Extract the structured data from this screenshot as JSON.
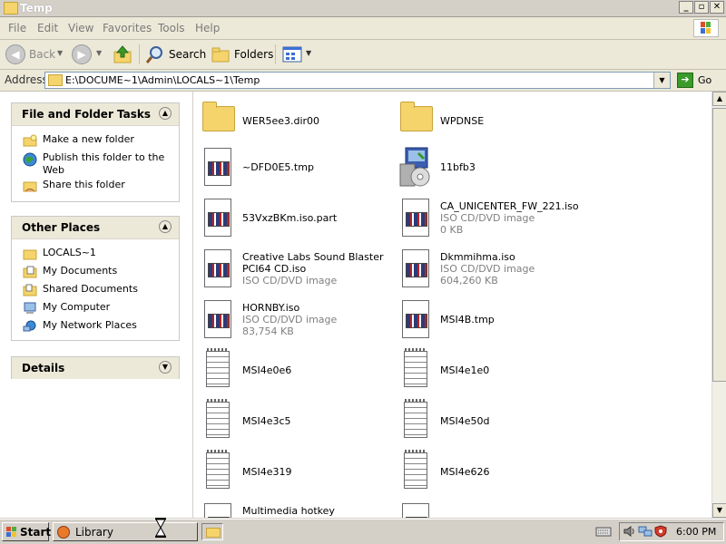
{
  "window": {
    "title": "Temp"
  },
  "menu": [
    "File",
    "Edit",
    "View",
    "Favorites",
    "Tools",
    "Help"
  ],
  "toolbar": {
    "back": "Back",
    "search": "Search",
    "folders": "Folders"
  },
  "address": {
    "label": "Address",
    "value": "E:\\DOCUME~1\\Admin\\LOCALS~1\\Temp",
    "go": "Go"
  },
  "left_panels": {
    "tasks": {
      "title": "File and Folder Tasks",
      "items": [
        "Make a new folder",
        "Publish this folder to the Web",
        "Share this folder"
      ]
    },
    "places": {
      "title": "Other Places",
      "items": [
        "LOCALS~1",
        "My Documents",
        "Shared Documents",
        "My Computer",
        "My Network Places"
      ]
    },
    "details": {
      "title": "Details"
    }
  },
  "files": [
    {
      "name": "WER5ee3.dir00",
      "icon": "folder"
    },
    {
      "name": "WPDNSE",
      "icon": "folder"
    },
    {
      "name": "~DFD0E5.tmp",
      "icon": "doc"
    },
    {
      "name": "11bfb3",
      "icon": "installer"
    },
    {
      "name": "53VxzBKm.iso.part",
      "icon": "doc"
    },
    {
      "name": "CA_UNICENTER_FW_221.iso",
      "type": "ISO CD/DVD image",
      "size": "0 KB",
      "icon": "doc"
    },
    {
      "name": "Creative Labs Sound Blaster PCI64 CD.iso",
      "type": "ISO CD/DVD image",
      "icon": "doc"
    },
    {
      "name": "Dkmmihma.iso",
      "type": "ISO CD/DVD image",
      "size": "604,260 KB",
      "icon": "doc"
    },
    {
      "name": "HORNBY.iso",
      "type": "ISO CD/DVD image",
      "size": "83,754 KB",
      "icon": "doc"
    },
    {
      "name": "MSI4B.tmp",
      "icon": "doc"
    },
    {
      "name": "MSI4e0e6",
      "icon": "note"
    },
    {
      "name": "MSI4e1e0",
      "icon": "note"
    },
    {
      "name": "MSI4e3c5",
      "icon": "note"
    },
    {
      "name": "MSI4e50d",
      "icon": "note"
    },
    {
      "name": "MSI4e319",
      "icon": "note"
    },
    {
      "name": "MSI4e626",
      "icon": "note"
    },
    {
      "name": "Multimedia hotkey installation.iso",
      "icon": "doc"
    },
    {
      "name": "",
      "icon": "doc"
    }
  ],
  "taskbar": {
    "start": "Start",
    "task": "Library",
    "clock": "6:00 PM"
  }
}
